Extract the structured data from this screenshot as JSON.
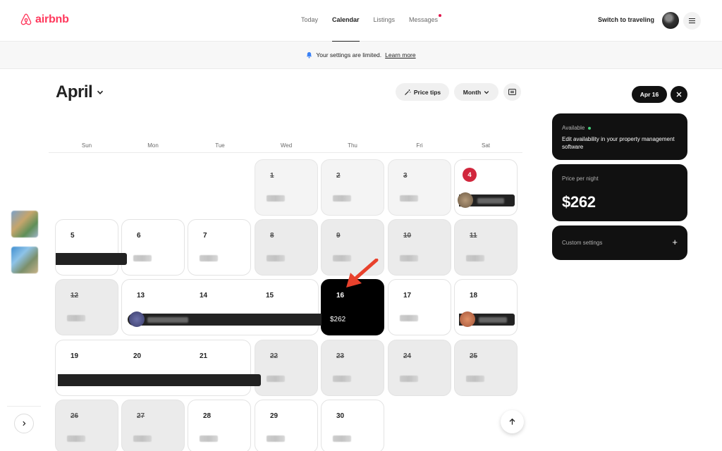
{
  "header": {
    "logo_text": "airbnb",
    "nav": [
      {
        "label": "Today",
        "active": false
      },
      {
        "label": "Calendar",
        "active": true
      },
      {
        "label": "Listings",
        "active": false
      },
      {
        "label": "Messages",
        "active": false,
        "notification": true
      }
    ],
    "switch_label": "Switch to traveling"
  },
  "banner": {
    "text": "Your settings are limited.",
    "link": "Learn more"
  },
  "calendar": {
    "month": "April",
    "price_tips": "Price tips",
    "view_mode": "Month",
    "weekdays": [
      "Sun",
      "Mon",
      "Tue",
      "Wed",
      "Thu",
      "Fri",
      "Sat"
    ],
    "days": {
      "d1": "1",
      "d2": "2",
      "d3": "3",
      "d4": "4",
      "d5": "5",
      "d6": "6",
      "d7": "7",
      "d8": "8",
      "d9": "9",
      "d10": "10",
      "d11": "11",
      "d12": "12",
      "d13": "13",
      "d14": "14",
      "d15": "15",
      "d16": "16",
      "d17": "17",
      "d18": "18",
      "d19": "19",
      "d20": "20",
      "d21": "21",
      "d22": "22",
      "d23": "23",
      "d24": "24",
      "d25": "25",
      "d26": "26",
      "d27": "27",
      "d28": "28",
      "d29": "29",
      "d30": "30"
    },
    "selected_price": "$262"
  },
  "panel": {
    "date_chip": "Apr 16",
    "availability_label": "Available",
    "availability_desc": "Edit availability in your property management software",
    "price_label": "Price per night",
    "price_value": "$262",
    "custom_label": "Custom settings",
    "plus": "+"
  },
  "colors": {
    "brand": "#FF385C",
    "today_badge": "#D1263C",
    "available_dot": "#44D17A",
    "annotation_arrow": "#E8412C"
  }
}
